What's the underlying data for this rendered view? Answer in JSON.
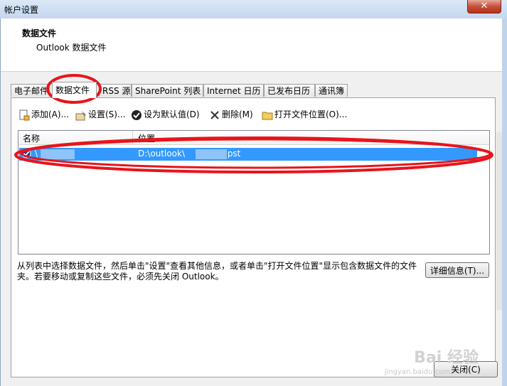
{
  "window": {
    "title": "帐户设置",
    "close_glyph": "✕"
  },
  "header": {
    "title": "数据文件",
    "subtitle": "Outlook 数据文件"
  },
  "tabs": [
    {
      "label": "电子邮件"
    },
    {
      "label": "数据文件"
    },
    {
      "label": "RSS 源"
    },
    {
      "label": "SharePoint 列表"
    },
    {
      "label": "Internet 日历"
    },
    {
      "label": "已发布日历"
    },
    {
      "label": "通讯簿"
    }
  ],
  "toolbar": {
    "add": "添加(A)...",
    "settings": "设置(S)...",
    "set_default": "设为默认值(D)",
    "remove": "删除(M)",
    "open_location": "打开文件位置(O)..."
  },
  "list": {
    "col_name": "名称",
    "col_location": "位置",
    "rows": [
      {
        "name": "\\",
        "location": "D:\\outlook\\",
        "location_suffix": ".pst"
      }
    ]
  },
  "description": "从列表中选择数据文件，然后单击\"设置\"查看其他信息，或者单击\"打开文件位置\"显示包含数据文件的文件夹。若要移动或复制这些文件，必须先关闭 Outlook。",
  "buttons": {
    "details": "详细信息(T)...",
    "close": "关闭(C)"
  },
  "colors": {
    "selection": "#3399ff",
    "annotation": "#e8141b"
  },
  "watermark": {
    "brand": "Bai 经验",
    "url": "jingyan.baidu.com"
  }
}
